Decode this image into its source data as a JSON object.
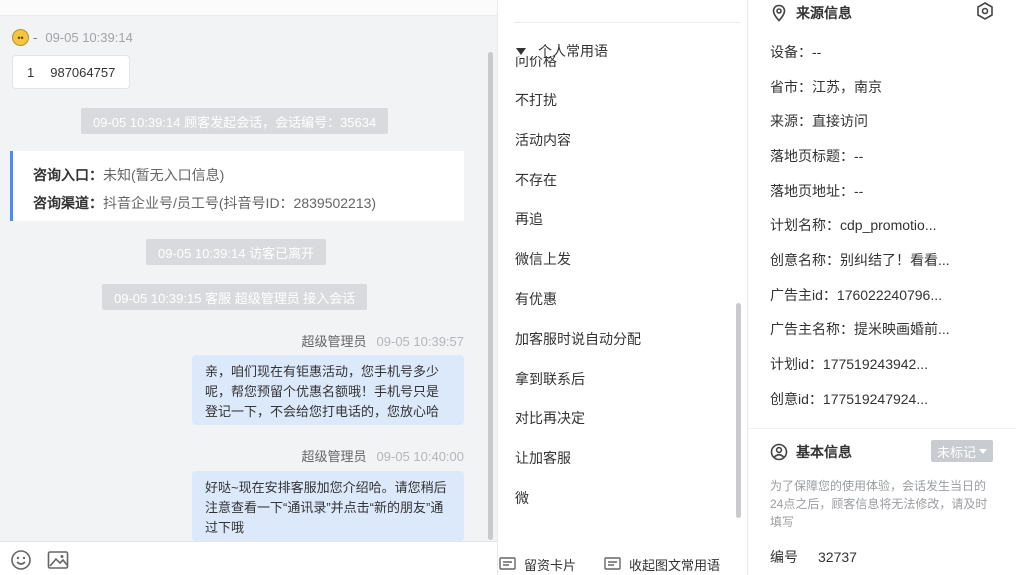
{
  "chat": {
    "visitor_sep": "-",
    "visitor_time": "09-05 10:39:14",
    "visitor_msg_num": "1",
    "visitor_msg_phone": "987064757",
    "sys_start": "09-05 10:39:14 顾客发起会话，会话编号：35634",
    "entry_label": "咨询入口：",
    "entry_value": "未知(暂无入口信息)",
    "channel_label": "咨询渠道：",
    "channel_value": "抖音企业号/员工号(抖音号ID：2839502213)",
    "sys_left": "09-05 10:39:14 访客已离开",
    "sys_join": "09-05 10:39:15 客服 超级管理员 接入会话",
    "msg1_sender": "超级管理员",
    "msg1_time": "09-05 10:39:57",
    "msg1_text": "亲，咱们现在有钜惠活动，您手机号多少呢，帮您预留个优惠名额哦！手机号只是登记一下，不会给您打电话的，您放心哈",
    "msg2_sender": "超级管理员",
    "msg2_time": "09-05 10:40:00",
    "msg2_text": "好哒~现在安排客服加您介绍哈。请您稍后注意查看一下“通讯录”并点击“新的朋友”通过下哦"
  },
  "phrases": {
    "group_label": "个人常用语",
    "clipped_item": "问价格",
    "items": [
      "不打扰",
      "活动内容",
      "不存在",
      "再追",
      "微信上发",
      "有优惠",
      "加客服时说自动分配",
      "拿到联系后",
      "对比再决定",
      "让加客服",
      "微"
    ],
    "btn_card": "留资卡片",
    "btn_collapse": "收起图文常用语"
  },
  "source": {
    "title": "来源信息",
    "rows": [
      {
        "label": "设备：",
        "value": "--"
      },
      {
        "label": "省市：",
        "value": "江苏，南京"
      },
      {
        "label": "来源：",
        "value": "直接访问"
      },
      {
        "label": "落地页标题：",
        "value": "--"
      },
      {
        "label": "落地页地址：",
        "value": "--"
      },
      {
        "label": "计划名称：",
        "value": "cdp_promotio..."
      },
      {
        "label": "创意名称：",
        "value": "别纠结了！看看..."
      },
      {
        "label": "广告主id：",
        "value": "176022240796..."
      },
      {
        "label": "广告主名称：",
        "value": "提米映画婚前..."
      },
      {
        "label": "计划id：",
        "value": "177519243942..."
      },
      {
        "label": "创意id：",
        "value": "177519247924..."
      }
    ]
  },
  "basic": {
    "title": "基本信息",
    "tag": "未标记",
    "notice": "为了保障您的使用体验，会话发生当日的24点之后，顾客信息将无法修改，请及时填写",
    "id_label": "编号",
    "id_value": "32737"
  },
  "icons": {
    "visitor_avatar": "emoji-face-icon",
    "emoji": "smile-icon",
    "image": "image-icon",
    "card": "card-icon",
    "collapse": "message-icon",
    "location": "location-pin-icon",
    "settings": "hexagon-settings-icon",
    "user": "user-circle-icon"
  },
  "colors": {
    "accent_blue": "#4a8cf7",
    "agent_bubble": "#dce9fb",
    "system_pill": "#d9dadd",
    "chat_bg": "#f2f3f5"
  }
}
